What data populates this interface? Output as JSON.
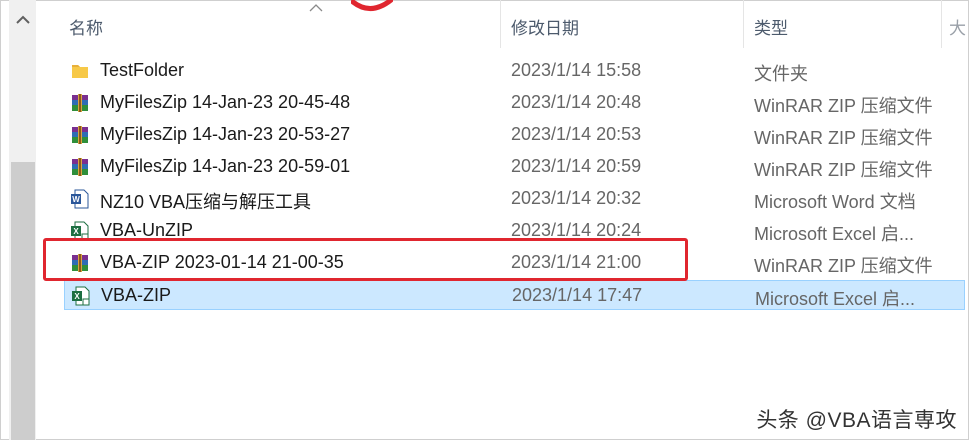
{
  "columns": {
    "name": "名称",
    "date": "修改日期",
    "type": "类型"
  },
  "rows": [
    {
      "icon": "folder-icon",
      "name": "TestFolder",
      "date": "2023/1/14 15:58",
      "type": "文件夹"
    },
    {
      "icon": "winrar-zip-icon",
      "name": "MyFilesZip  14-Jan-23 20-45-48",
      "date": "2023/1/14 20:48",
      "type": "WinRAR ZIP 压缩文件"
    },
    {
      "icon": "winrar-zip-icon",
      "name": "MyFilesZip  14-Jan-23 20-53-27",
      "date": "2023/1/14 20:53",
      "type": "WinRAR ZIP 压缩文件"
    },
    {
      "icon": "winrar-zip-icon",
      "name": "MyFilesZip  14-Jan-23 20-59-01",
      "date": "2023/1/14 20:59",
      "type": "WinRAR ZIP 压缩文件"
    },
    {
      "icon": "word-doc-icon",
      "name": "NZ10 VBA压缩与解压工具",
      "date": "2023/1/14 20:32",
      "type": "Microsoft Word 文档"
    },
    {
      "icon": "excel-macro-icon",
      "name": "VBA-UnZIP",
      "date": "2023/1/14 20:24",
      "type": "Microsoft Excel 启..."
    },
    {
      "icon": "winrar-zip-icon",
      "name": "VBA-ZIP 2023-01-14 21-00-35",
      "date": "2023/1/14 21:00",
      "type": "WinRAR ZIP 压缩文件"
    },
    {
      "icon": "excel-macro-icon",
      "name": "VBA-ZIP",
      "date": "2023/1/14 17:47",
      "type": "Microsoft Excel 启..."
    }
  ],
  "selected_row": 7,
  "highlighted_row": 6,
  "watermark": "头条 @VBA语言専攻",
  "colors": {
    "selection": "#cce8ff",
    "highlight_border": "#e0262f",
    "folder": "#f7c948",
    "excel": "#1d6f42",
    "word": "#2b579a"
  }
}
